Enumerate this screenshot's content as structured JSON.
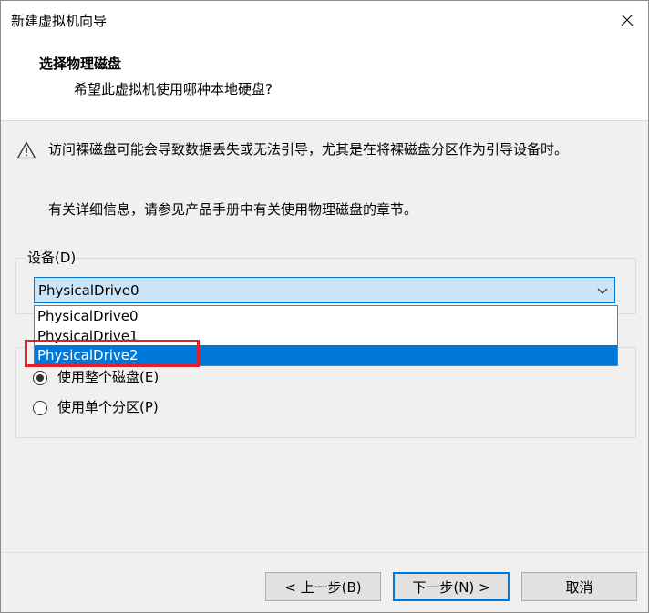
{
  "window": {
    "title": "新建虚拟机向导"
  },
  "header": {
    "title": "选择物理磁盘",
    "subtitle": "希望此虚拟机使用哪种本地硬盘?"
  },
  "warning": {
    "text": "访问裸磁盘可能会导致数据丢失或无法引导，尤其是在将裸磁盘分区作为引导设备时。",
    "info": "有关详细信息，请参见产品手册中有关使用物理磁盘的章节。"
  },
  "device": {
    "label": "设备(D)",
    "selected": "PhysicalDrive0",
    "options": [
      "PhysicalDrive0",
      "PhysicalDrive1",
      "PhysicalDrive2"
    ],
    "highlighted_option": "PhysicalDrive2"
  },
  "usage": {
    "options": [
      {
        "label": "使用整个磁盘(E)",
        "checked": true
      },
      {
        "label": "使用单个分区(P)",
        "checked": false
      }
    ]
  },
  "buttons": {
    "back": "< 上一步(B)",
    "next": "下一步(N) >",
    "cancel": "取消"
  },
  "colors": {
    "accent": "#0078d7",
    "selection_bg": "#0078d7",
    "combo_bg": "#cce4f7",
    "highlight_box": "#e0202a"
  },
  "icons": {
    "close": "close-icon",
    "warning": "warning-icon",
    "combo_arrow": "chevron-down-icon"
  }
}
